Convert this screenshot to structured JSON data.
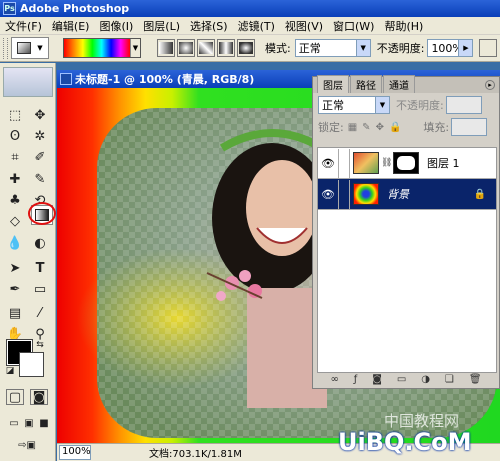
{
  "app": {
    "title": "Adobe Photoshop"
  },
  "menu": [
    "文件(F)",
    "编辑(E)",
    "图像(I)",
    "图层(L)",
    "选择(S)",
    "滤镜(T)",
    "视图(V)",
    "窗口(W)",
    "帮助(H)"
  ],
  "options": {
    "mode_label": "模式:",
    "mode_value": "正常",
    "opacity_label": "不透明度:",
    "opacity_value": "100%"
  },
  "document": {
    "title": "未标题-1 @ 100% (青晨, RGB/8)",
    "zoom": "100%",
    "doc_info": "文档:703.1K/1.81M"
  },
  "layers_panel": {
    "tabs": [
      "图层",
      "路径",
      "通道"
    ],
    "blend_mode": "正常",
    "opacity_label": "不透明度:",
    "lock_label": "锁定:",
    "fill_label": "填充:",
    "layers": [
      {
        "name": "图层 1",
        "selected": false
      },
      {
        "name": "背景",
        "selected": true
      }
    ]
  },
  "colors": {
    "foreground": "#000000",
    "background": "#ffffff",
    "selection": "#0a246a"
  },
  "watermark": {
    "line1": "中国教程网",
    "line2": "UiBQ.CoM"
  }
}
